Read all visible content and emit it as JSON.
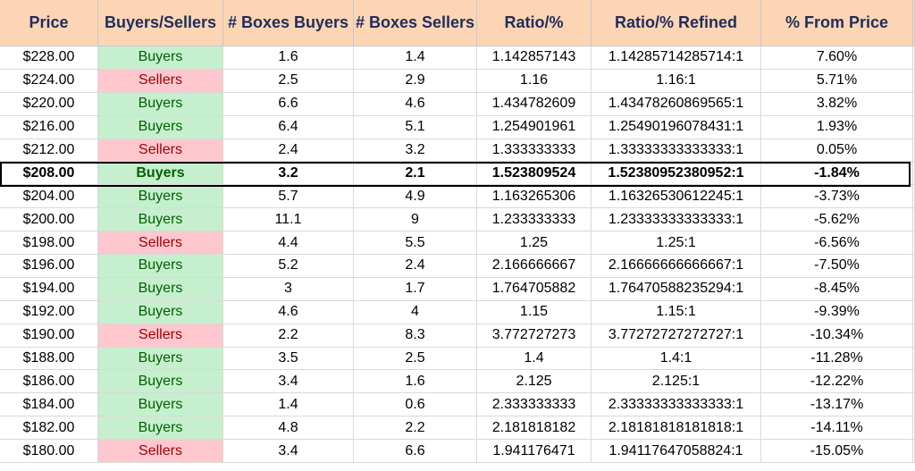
{
  "headers": [
    "Price",
    "Buyers/Sellers",
    "# Boxes Buyers",
    "# Boxes Sellers",
    "Ratio/%",
    "Ratio/% Refined",
    "% From Price"
  ],
  "highlight_row": 5,
  "colors": {
    "header_bg": "#fcd5b4",
    "header_text": "#1f2d5c",
    "buyers_bg": "#c6efce",
    "buyers_text": "#006100",
    "sellers_bg": "#ffc7ce",
    "sellers_text": "#9c0006"
  },
  "rows": [
    {
      "price": "$228.00",
      "side": "Buyers",
      "boxes_buyers": "1.6",
      "boxes_sellers": "1.4",
      "ratio": "1.142857143",
      "ratio_refined": "1.14285714285714:1",
      "pct_from_price": "7.60%"
    },
    {
      "price": "$224.00",
      "side": "Sellers",
      "boxes_buyers": "2.5",
      "boxes_sellers": "2.9",
      "ratio": "1.16",
      "ratio_refined": "1.16:1",
      "pct_from_price": "5.71%"
    },
    {
      "price": "$220.00",
      "side": "Buyers",
      "boxes_buyers": "6.6",
      "boxes_sellers": "4.6",
      "ratio": "1.434782609",
      "ratio_refined": "1.43478260869565:1",
      "pct_from_price": "3.82%"
    },
    {
      "price": "$216.00",
      "side": "Buyers",
      "boxes_buyers": "6.4",
      "boxes_sellers": "5.1",
      "ratio": "1.254901961",
      "ratio_refined": "1.25490196078431:1",
      "pct_from_price": "1.93%"
    },
    {
      "price": "$212.00",
      "side": "Sellers",
      "boxes_buyers": "2.4",
      "boxes_sellers": "3.2",
      "ratio": "1.333333333",
      "ratio_refined": "1.33333333333333:1",
      "pct_from_price": "0.05%"
    },
    {
      "price": "$208.00",
      "side": "Buyers",
      "boxes_buyers": "3.2",
      "boxes_sellers": "2.1",
      "ratio": "1.523809524",
      "ratio_refined": "1.52380952380952:1",
      "pct_from_price": "-1.84%"
    },
    {
      "price": "$204.00",
      "side": "Buyers",
      "boxes_buyers": "5.7",
      "boxes_sellers": "4.9",
      "ratio": "1.163265306",
      "ratio_refined": "1.16326530612245:1",
      "pct_from_price": "-3.73%"
    },
    {
      "price": "$200.00",
      "side": "Buyers",
      "boxes_buyers": "11.1",
      "boxes_sellers": "9",
      "ratio": "1.233333333",
      "ratio_refined": "1.23333333333333:1",
      "pct_from_price": "-5.62%"
    },
    {
      "price": "$198.00",
      "side": "Sellers",
      "boxes_buyers": "4.4",
      "boxes_sellers": "5.5",
      "ratio": "1.25",
      "ratio_refined": "1.25:1",
      "pct_from_price": "-6.56%"
    },
    {
      "price": "$196.00",
      "side": "Buyers",
      "boxes_buyers": "5.2",
      "boxes_sellers": "2.4",
      "ratio": "2.166666667",
      "ratio_refined": "2.16666666666667:1",
      "pct_from_price": "-7.50%"
    },
    {
      "price": "$194.00",
      "side": "Buyers",
      "boxes_buyers": "3",
      "boxes_sellers": "1.7",
      "ratio": "1.764705882",
      "ratio_refined": "1.76470588235294:1",
      "pct_from_price": "-8.45%"
    },
    {
      "price": "$192.00",
      "side": "Buyers",
      "boxes_buyers": "4.6",
      "boxes_sellers": "4",
      "ratio": "1.15",
      "ratio_refined": "1.15:1",
      "pct_from_price": "-9.39%"
    },
    {
      "price": "$190.00",
      "side": "Sellers",
      "boxes_buyers": "2.2",
      "boxes_sellers": "8.3",
      "ratio": "3.772727273",
      "ratio_refined": "3.77272727272727:1",
      "pct_from_price": "-10.34%"
    },
    {
      "price": "$188.00",
      "side": "Buyers",
      "boxes_buyers": "3.5",
      "boxes_sellers": "2.5",
      "ratio": "1.4",
      "ratio_refined": "1.4:1",
      "pct_from_price": "-11.28%"
    },
    {
      "price": "$186.00",
      "side": "Buyers",
      "boxes_buyers": "3.4",
      "boxes_sellers": "1.6",
      "ratio": "2.125",
      "ratio_refined": "2.125:1",
      "pct_from_price": "-12.22%"
    },
    {
      "price": "$184.00",
      "side": "Buyers",
      "boxes_buyers": "1.4",
      "boxes_sellers": "0.6",
      "ratio": "2.333333333",
      "ratio_refined": "2.33333333333333:1",
      "pct_from_price": "-13.17%"
    },
    {
      "price": "$182.00",
      "side": "Buyers",
      "boxes_buyers": "4.8",
      "boxes_sellers": "2.2",
      "ratio": "2.181818182",
      "ratio_refined": "2.18181818181818:1",
      "pct_from_price": "-14.11%"
    },
    {
      "price": "$180.00",
      "side": "Sellers",
      "boxes_buyers": "3.4",
      "boxes_sellers": "6.6",
      "ratio": "1.941176471",
      "ratio_refined": "1.94117647058824:1",
      "pct_from_price": "-15.05%"
    }
  ]
}
